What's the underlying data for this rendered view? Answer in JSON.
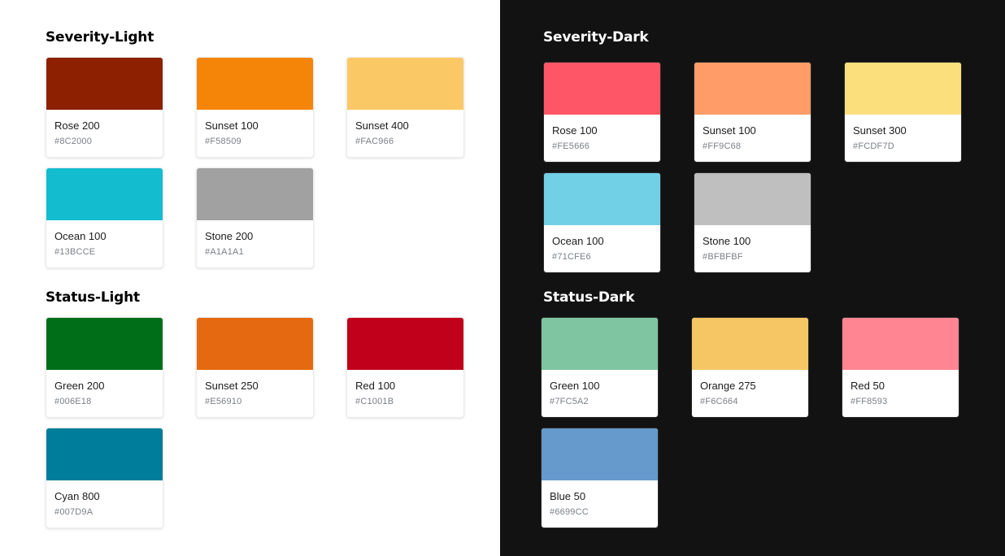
{
  "light": {
    "severity": {
      "title": "Severity-Light",
      "cards": [
        {
          "name": "Rose 200",
          "hex": "#8C2000",
          "color": "#8C2000"
        },
        {
          "name": "Sunset 100",
          "hex": "#F58509",
          "color": "#F58509"
        },
        {
          "name": "Sunset 400",
          "hex": "#FAC966",
          "color": "#FAC966"
        },
        {
          "name": "Ocean 100",
          "hex": "#13BCCE",
          "color": "#13BCCE"
        },
        {
          "name": "Stone 200",
          "hex": "#A1A1A1",
          "color": "#A1A1A1"
        }
      ]
    },
    "status": {
      "title": "Status-Light",
      "cards": [
        {
          "name": "Green 200",
          "hex": "#006E18",
          "color": "#006E18"
        },
        {
          "name": "Sunset 250",
          "hex": "#E56910",
          "color": "#E56910"
        },
        {
          "name": "Red 100",
          "hex": "#C1001B",
          "color": "#C1001B"
        },
        {
          "name": "Cyan 800",
          "hex": "#007D9A",
          "color": "#007D9A"
        }
      ]
    }
  },
  "dark": {
    "severity": {
      "title": "Severity-Dark",
      "cards": [
        {
          "name": "Rose 100",
          "hex": "#FE5666",
          "color": "#FE5666"
        },
        {
          "name": "Sunset 100",
          "hex": "#FF9C68",
          "color": "#FF9C68"
        },
        {
          "name": "Sunset 300",
          "hex": "#FCDF7D",
          "color": "#FCDF7D"
        },
        {
          "name": "Ocean 100",
          "hex": "#71CFE6",
          "color": "#71CFE6"
        },
        {
          "name": "Stone 100",
          "hex": "#BFBFBF",
          "color": "#BFBFBF"
        }
      ]
    },
    "status": {
      "title": "Status-Dark",
      "cards": [
        {
          "name": "Green 100",
          "hex": "#7FC5A2",
          "color": "#7FC5A2"
        },
        {
          "name": "Orange 275",
          "hex": "#F6C664",
          "color": "#F6C664"
        },
        {
          "name": "Red 50",
          "hex": "#FF8593",
          "color": "#FF8593"
        },
        {
          "name": "Blue 50",
          "hex": "#6699CC",
          "color": "#6699CC"
        }
      ]
    }
  }
}
